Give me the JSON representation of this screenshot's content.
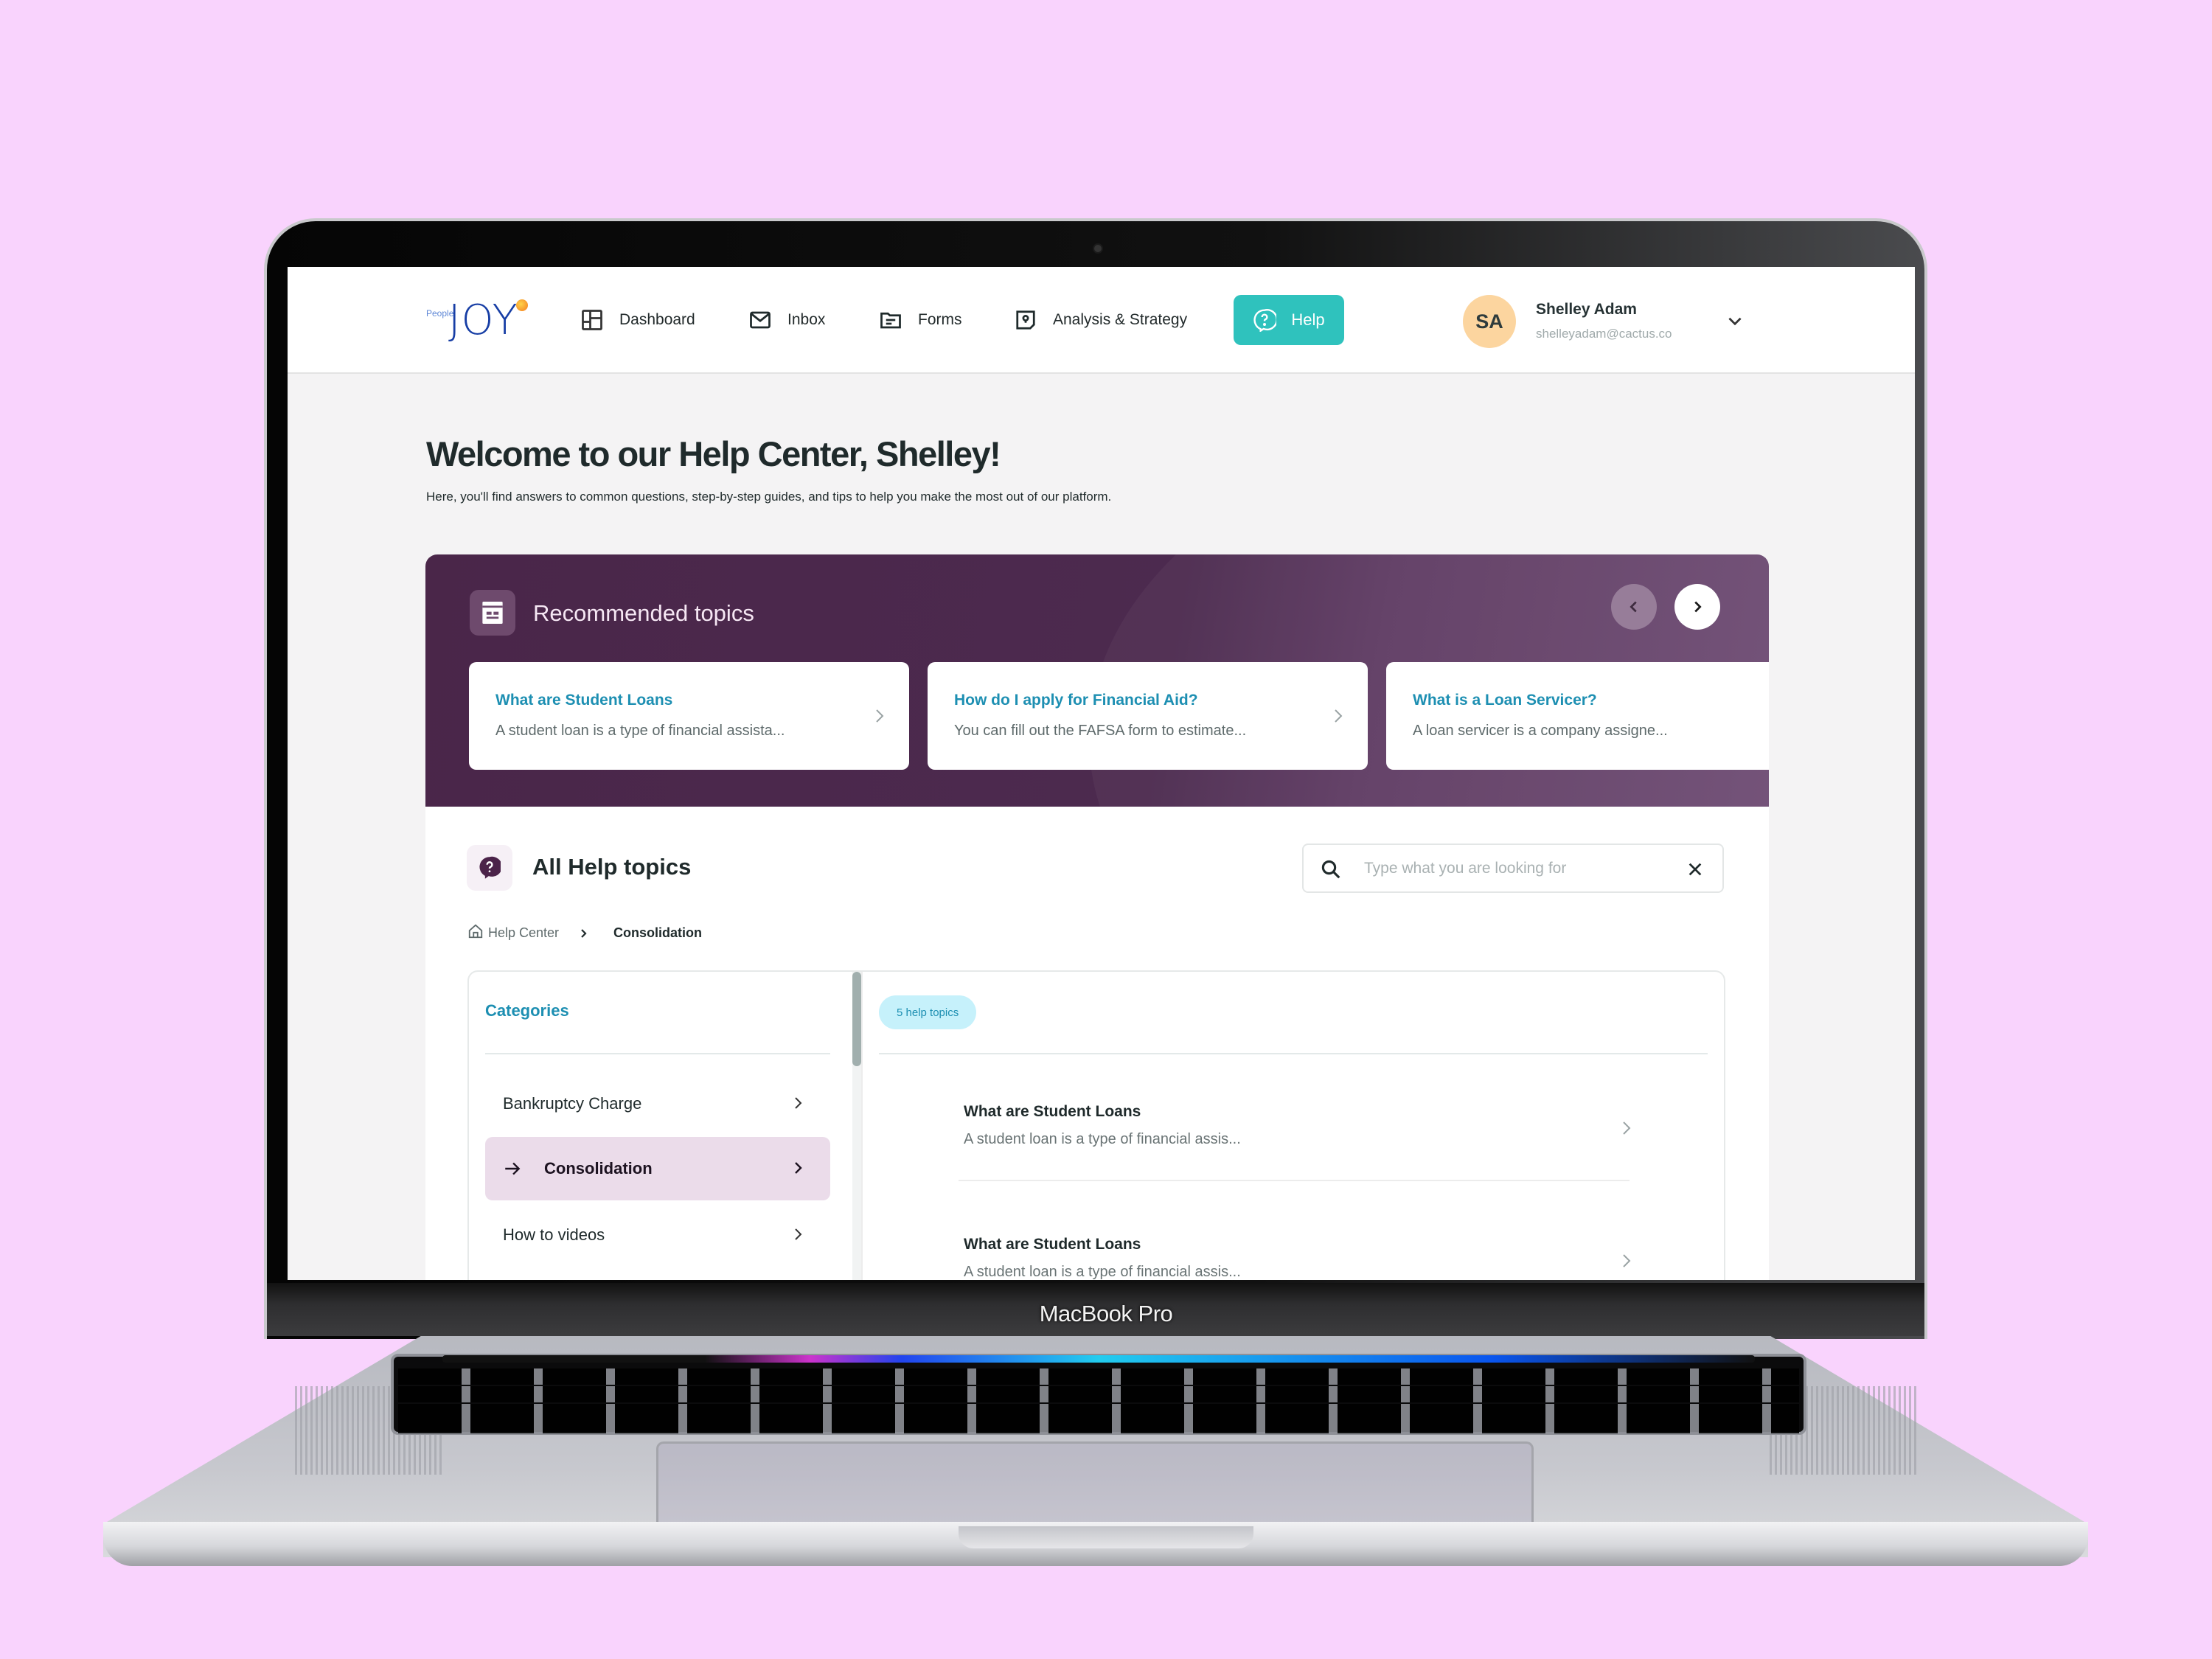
{
  "device": {
    "label": "MacBook Pro"
  },
  "app": {
    "logo": {
      "small": "People",
      "big": "JOY"
    },
    "nav": [
      {
        "label": "Dashboard",
        "icon": "dashboard-icon"
      },
      {
        "label": "Inbox",
        "icon": "mail-icon"
      },
      {
        "label": "Forms",
        "icon": "folder-form-icon"
      },
      {
        "label": "Analysis & Strategy",
        "icon": "map-pin-icon"
      }
    ],
    "help_button": {
      "label": "Help",
      "icon": "help-bubble-icon",
      "active": true
    },
    "user": {
      "initials": "SA",
      "name": "Shelley Adam",
      "email": "shelleyadam@cactus.co"
    }
  },
  "page": {
    "title": "Welcome to our Help Center, Shelley!",
    "subtitle": "Here, you'll find answers to common questions, step-by-step guides, and tips to help you make the most out of our platform."
  },
  "recommended": {
    "title": "Recommended topics",
    "cards": [
      {
        "title": "What are Student Loans",
        "description": "A student loan is a type of financial assista..."
      },
      {
        "title": "How do I apply for Financial Aid?",
        "description": "You can fill out the FAFSA form to estimate..."
      },
      {
        "title": "What is a Loan Servicer?",
        "description": "A loan servicer is a company assigne..."
      }
    ]
  },
  "all_topics": {
    "title": "All Help topics",
    "search": {
      "placeholder": "Type what you are looking for",
      "value": ""
    },
    "breadcrumb": {
      "home": "Help Center",
      "current": "Consolidation"
    },
    "categories": {
      "title": "Categories",
      "items": [
        {
          "label": "Bankruptcy Charge",
          "active": false
        },
        {
          "label": "Consolidation",
          "active": true
        },
        {
          "label": "How to videos",
          "active": false
        }
      ]
    },
    "count_badge": "5 help topics",
    "topics": [
      {
        "title": "What are Student Loans",
        "description": "A student loan is a type of financial assis..."
      },
      {
        "title": "What are Student Loans",
        "description": "A student loan is a type of financial assis..."
      }
    ]
  },
  "colors": {
    "background": "#f9d3fd",
    "accent_teal": "#2fc2bd",
    "banner_purple": "#4c2a4f",
    "link_blue": "#1d8fb2",
    "active_category": "#ebdcea",
    "badge_bg": "#c6f1fb",
    "avatar_bg": "#fcd59f"
  }
}
